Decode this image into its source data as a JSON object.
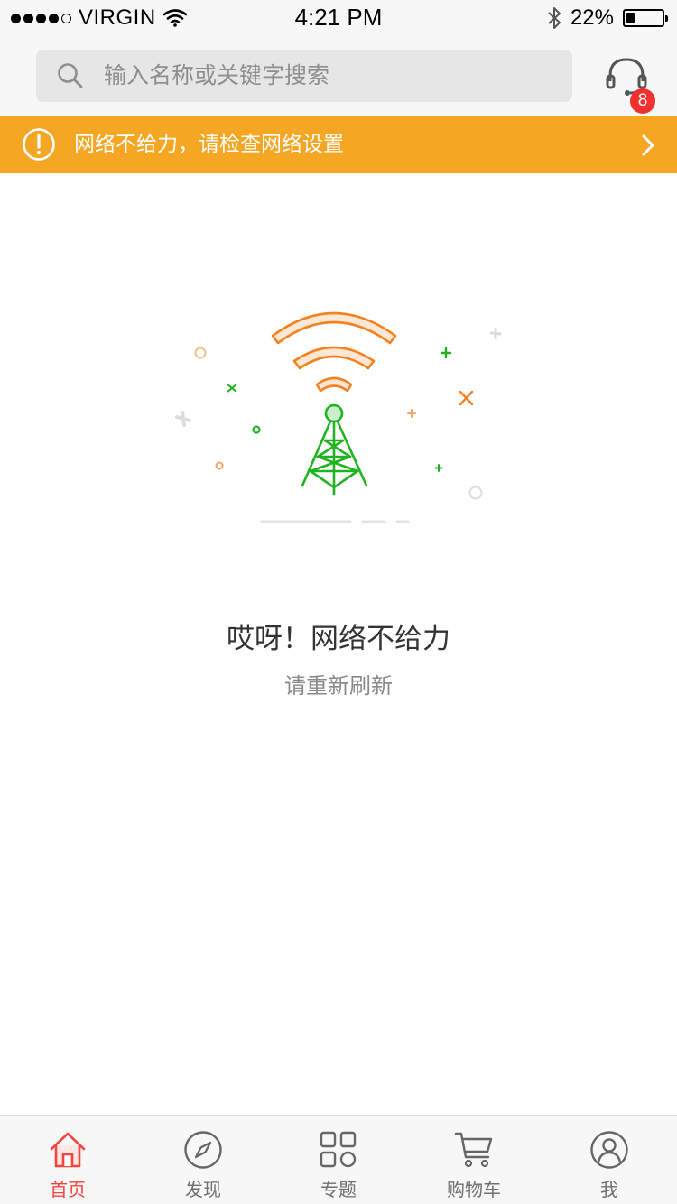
{
  "status_bar": {
    "carrier": "VIRGIN",
    "time": "4:21 PM",
    "battery": "22%",
    "battery_level": 0.22
  },
  "search": {
    "placeholder": "输入名称或关键字搜索"
  },
  "service": {
    "badge_count": "8"
  },
  "banner": {
    "text": "网络不给力，请检查网络设置",
    "color": "#f5a623"
  },
  "error": {
    "title": "哎呀！网络不给力",
    "subtitle": "请重新刷新"
  },
  "tabs": [
    {
      "label": "首页",
      "icon": "home-icon",
      "active": true
    },
    {
      "label": "发现",
      "icon": "compass-icon",
      "active": false
    },
    {
      "label": "专题",
      "icon": "grid-icon",
      "active": false
    },
    {
      "label": "购物车",
      "icon": "cart-icon",
      "active": false
    },
    {
      "label": "我",
      "icon": "user-icon",
      "active": false
    }
  ],
  "colors": {
    "accent": "#f2453d",
    "orange": "#f5a623",
    "tower_green": "#1fb41f",
    "wave_orange": "#f5821f"
  }
}
